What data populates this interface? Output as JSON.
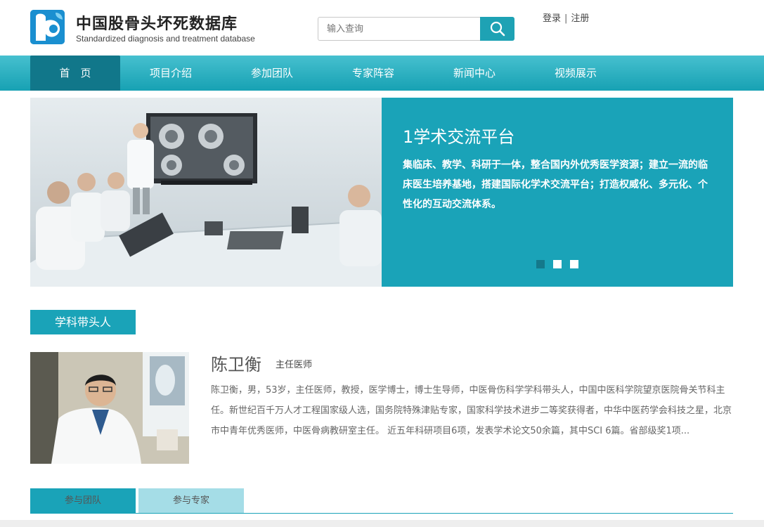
{
  "header": {
    "title": "中国股骨头坏死数据库",
    "subtitle": "Standardized diagnosis and treatment database",
    "search_placeholder": "输入查询",
    "login": "登录",
    "separator": "|",
    "register": "注册"
  },
  "nav": {
    "items": [
      {
        "label": "首　页",
        "active": true
      },
      {
        "label": "项目介绍",
        "active": false
      },
      {
        "label": "参加团队",
        "active": false
      },
      {
        "label": "专家阵容",
        "active": false
      },
      {
        "label": "新闻中心",
        "active": false
      },
      {
        "label": "视频展示",
        "active": false
      }
    ]
  },
  "banner": {
    "title": "1学术交流平台",
    "text": "集临床、教学、科研于一体，整合国内外优秀医学资源；建立一流的临床医生培养基地，搭建国际化学术交流平台；打造权威化、多元化、个性化的互动交流体系。",
    "slide_count": 3,
    "active_slide": 1
  },
  "section": {
    "leaders_label": "学科带头人"
  },
  "profile": {
    "name": "陈卫衡",
    "title": "主任医师",
    "bio": "陈卫衡，男，53岁，主任医师，教授，医学博士，博士生导师，中医骨伤科学学科带头人，中国中医科学院望京医院骨关节科主任。新世纪百千万人才工程国家级人选，国务院特殊津贴专家，国家科学技术进步二等奖获得者，中华中医药学会科技之星，北京市中青年优秀医师，中医骨病教研室主任。 近五年科研项目6项，发表学术论文50余篇，其中SCI 6篇。省部级奖1项..."
  },
  "tabs": {
    "items": [
      {
        "label": "参与团队",
        "active": true
      },
      {
        "label": "参与专家",
        "active": false
      }
    ]
  },
  "colors": {
    "accent": "#1aa3b8",
    "nav_active": "#11778a",
    "tab_inactive": "#a5dde7"
  }
}
